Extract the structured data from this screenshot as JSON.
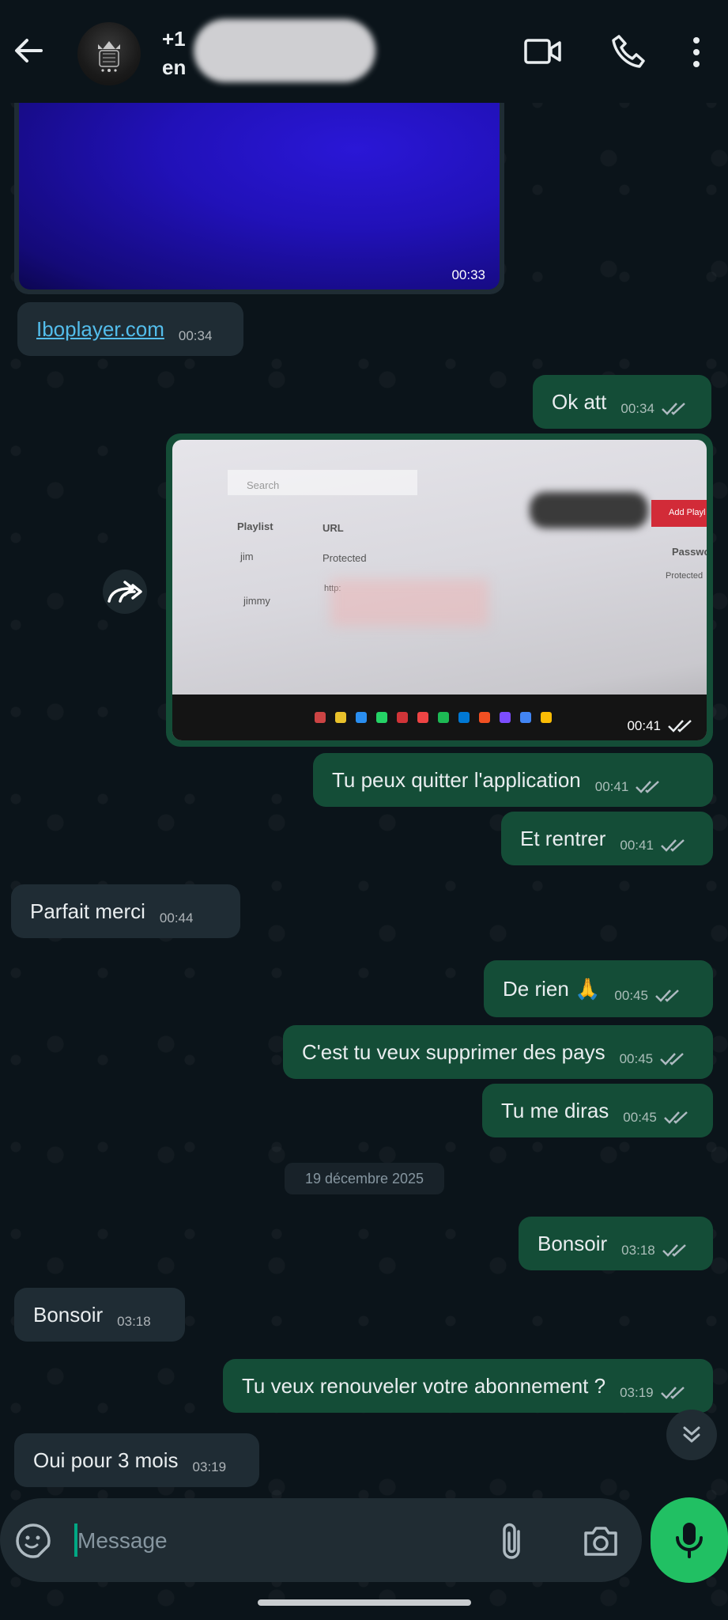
{
  "header": {
    "contact_line1": "+1",
    "contact_line2": "en",
    "icons": [
      "back-arrow-icon",
      "video-call-icon",
      "phone-icon",
      "more-vert-icon"
    ]
  },
  "messages": [
    {
      "dir": "in",
      "type": "video",
      "time": "00:33"
    },
    {
      "dir": "in",
      "type": "link",
      "text": "Iboplayer.com",
      "time": "00:34"
    },
    {
      "dir": "out",
      "text": "Ok att",
      "time": "00:34"
    },
    {
      "dir": "out",
      "type": "photo",
      "time": "00:41",
      "photo_text": {
        "search": "Search",
        "col_playlist": "Playlist",
        "col_url": "URL",
        "col_password": "Password",
        "row1_name": "jim",
        "row1_url": "Protected",
        "row2_name": "jimmy",
        "row2_url": "http:",
        "right_protected": "Protected",
        "add_btn": "Add Playl"
      }
    },
    {
      "dir": "out",
      "text": "Tu peux quitter l'application",
      "time": "00:41"
    },
    {
      "dir": "out",
      "text": "Et rentrer",
      "time": "00:41"
    },
    {
      "dir": "in",
      "text": "Parfait merci",
      "time": "00:44"
    },
    {
      "dir": "out",
      "text": "De rien 🙏",
      "time": "00:45"
    },
    {
      "dir": "out",
      "text": "C'est tu veux supprimer des pays",
      "time": "00:45"
    },
    {
      "dir": "out",
      "text": "Tu me diras",
      "time": "00:45"
    },
    {
      "dir": "out",
      "text": "Bonsoir",
      "time": "03:18"
    },
    {
      "dir": "in",
      "text": "Bonsoir",
      "time": "03:18"
    },
    {
      "dir": "out",
      "text": "Tu veux renouveler votre abonnement ?",
      "time": "03:19"
    },
    {
      "dir": "in",
      "text": "Oui pour 3 mois",
      "time": "03:19"
    }
  ],
  "date_separator": "19 décembre 2025",
  "composer": {
    "placeholder": "Message"
  },
  "colors": {
    "incoming": "#1f2c34",
    "outgoing": "#144d37",
    "accent": "#21c063",
    "link": "#53bdeb"
  }
}
